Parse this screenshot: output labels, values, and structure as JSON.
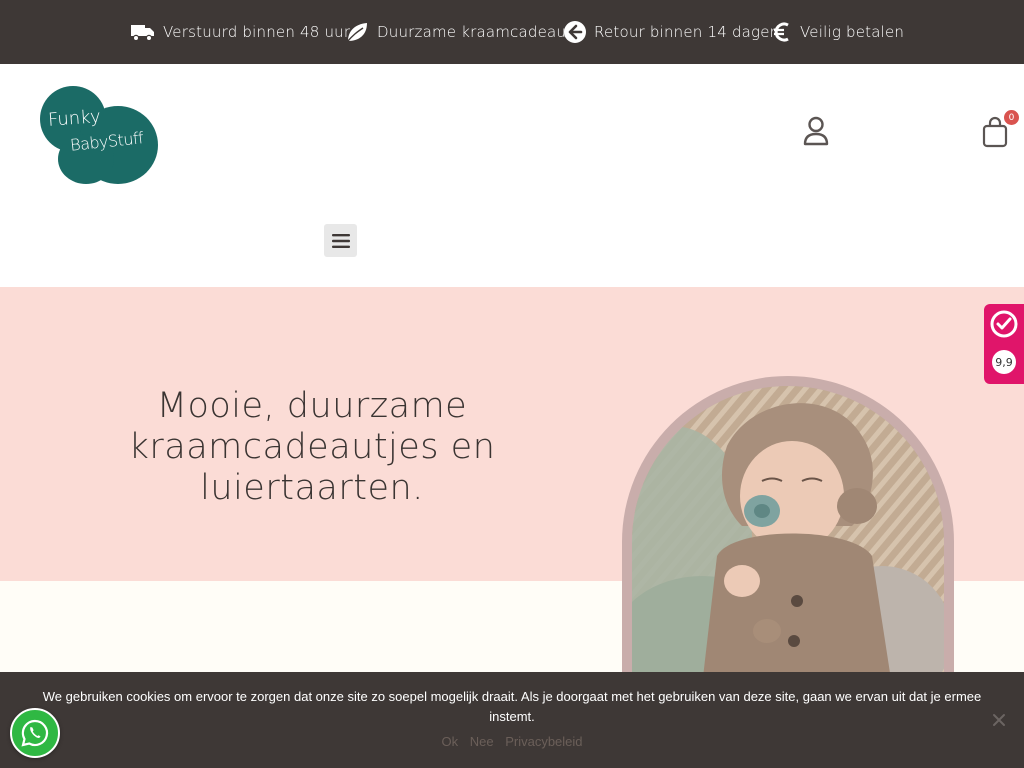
{
  "topbar": {
    "items": [
      {
        "label": "Verstuurd binnen 48 uur",
        "icon": "truck-icon"
      },
      {
        "label": "Duurzame kraamcadeaus",
        "icon": "leaf-icon"
      },
      {
        "label": "Retour binnen 14 dagen",
        "icon": "arrow-left-circle-icon"
      },
      {
        "label": "Veilig betalen",
        "icon": "euro-icon"
      }
    ]
  },
  "header": {
    "logo": {
      "line1": "Funky",
      "line2": "BabyStuff"
    },
    "cart_count": "0"
  },
  "hero": {
    "title": "Mooie, duurzame kraamcadeautjes en luiertaarten."
  },
  "rating_widget": {
    "score": "9,9"
  },
  "cookie_notice": {
    "text": "We gebruiken cookies om ervoor te zorgen dat onze site zo soepel mogelijk draait. Als je doorgaat met het gebruiken van deze site, gaan we ervan uit dat je ermee instemt.",
    "ok_label": "Ok",
    "no_label": "Nee",
    "privacy_label": "Privacybeleid"
  },
  "colors": {
    "topbar_bg": "#3e3836",
    "hero_bg": "#fbdcd6",
    "brand_teal": "#1b6b66",
    "rating_pink": "#e0156a",
    "whatsapp_green": "#2fb843"
  }
}
